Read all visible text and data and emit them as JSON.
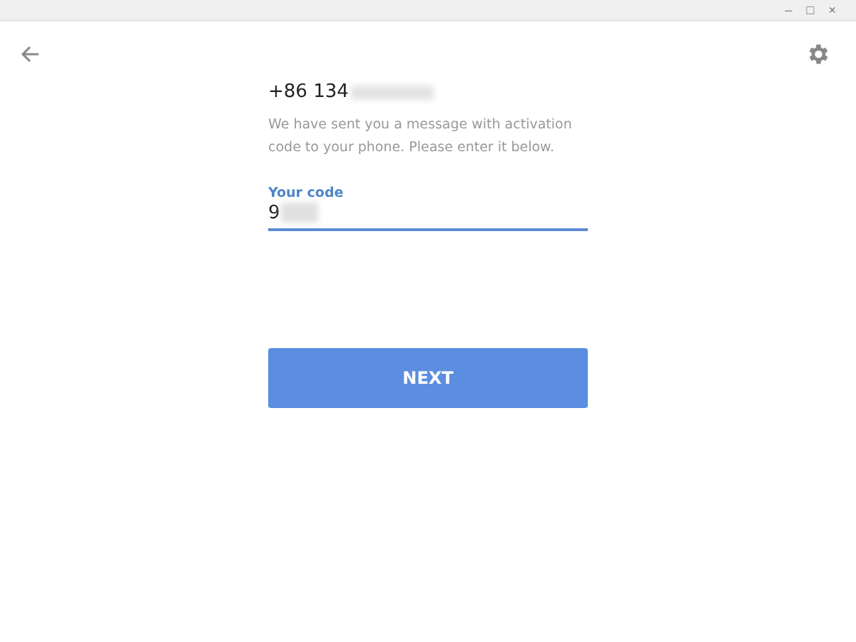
{
  "window": {
    "buttons": [
      "–",
      "□",
      "×"
    ]
  },
  "phone": "+86 134",
  "message": "We have sent you a message with activation code to your phone. Please enter it below.",
  "code_field": {
    "label": "Your code",
    "value": "9"
  },
  "next_button": "NEXT"
}
